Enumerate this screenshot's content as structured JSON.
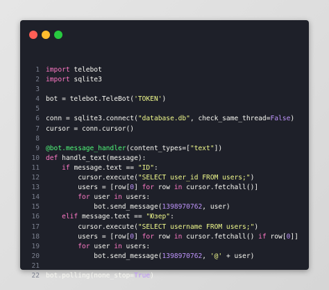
{
  "window": {
    "controls": [
      {
        "name": "close",
        "color": "#ff5f56"
      },
      {
        "name": "minimize",
        "color": "#ffbd2e"
      },
      {
        "name": "maximize",
        "color": "#27c93f"
      }
    ]
  },
  "code": {
    "lines": [
      {
        "n": "1",
        "text": "import telebot"
      },
      {
        "n": "2",
        "text": "import sqlite3"
      },
      {
        "n": "3",
        "text": ""
      },
      {
        "n": "4",
        "text": "bot = telebot.TeleBot('TOKEN')"
      },
      {
        "n": "5",
        "text": ""
      },
      {
        "n": "6",
        "text": "conn = sqlite3.connect(\"database.db\", check_same_thread=False)"
      },
      {
        "n": "7",
        "text": "cursor = conn.cursor()"
      },
      {
        "n": "8",
        "text": ""
      },
      {
        "n": "9",
        "text": "@bot.message_handler(content_types=[\"text\"])"
      },
      {
        "n": "10",
        "text": "def handle_text(message):"
      },
      {
        "n": "11",
        "text": "    if message.text == \"ID\":"
      },
      {
        "n": "12",
        "text": "        cursor.execute(\"SELECT user_id FROM users;\")"
      },
      {
        "n": "13",
        "text": "        users = [row[0] for row in cursor.fetchall()]"
      },
      {
        "n": "14",
        "text": "        for user in users:"
      },
      {
        "n": "15",
        "text": "            bot.send_message(1398970762, user)"
      },
      {
        "n": "16",
        "text": "    elif message.text == \"Юзер\":"
      },
      {
        "n": "17",
        "text": "        cursor.execute(\"SELECT username FROM users;\")"
      },
      {
        "n": "18",
        "text": "        users = [row[0] for row in cursor.fetchall() if row[0]]"
      },
      {
        "n": "19",
        "text": "        for user in users:"
      },
      {
        "n": "20",
        "text": "            bot.send_message(1398970762, '@' + user)"
      },
      {
        "n": "21",
        "text": ""
      },
      {
        "n": "22",
        "text": "bot.polling(none_stop=True)"
      }
    ]
  }
}
